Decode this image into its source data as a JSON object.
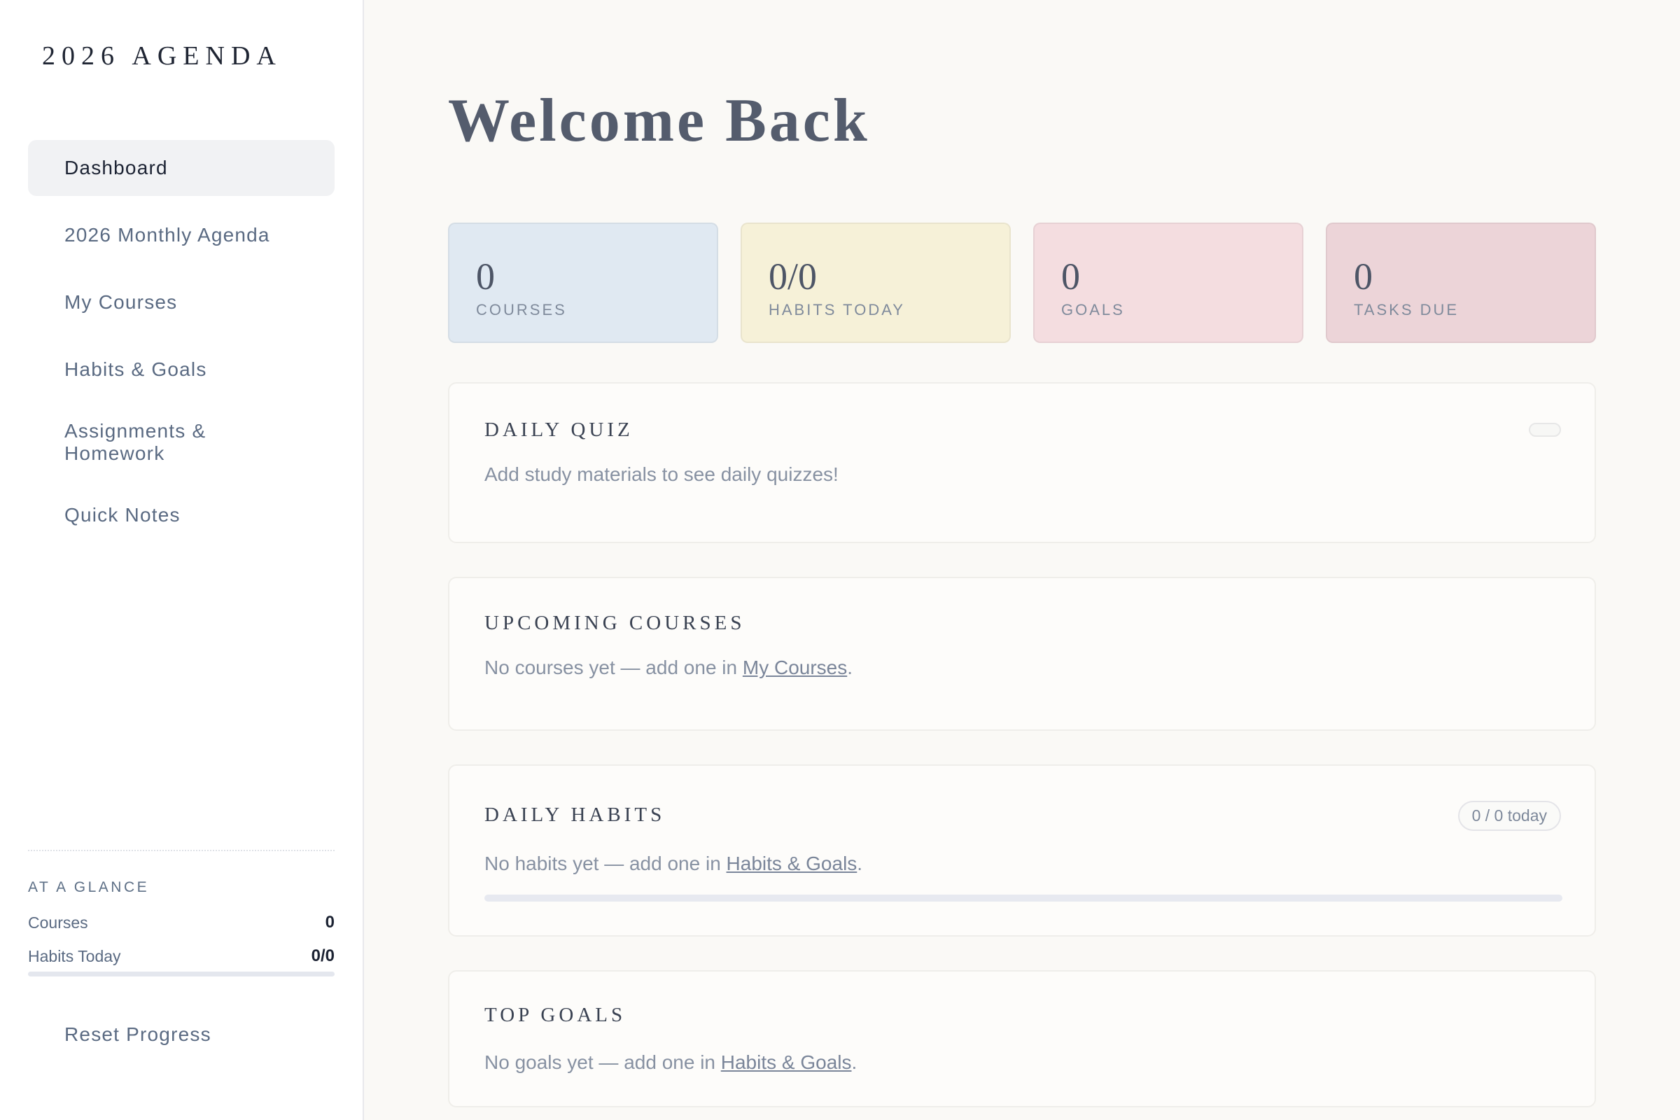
{
  "sidebar": {
    "brand": "2026 AGENDA",
    "nav": [
      {
        "label": "Dashboard",
        "active": true
      },
      {
        "label": "2026 Monthly Agenda"
      },
      {
        "label": "My Courses"
      },
      {
        "label": "Habits & Goals"
      },
      {
        "label": "Assignments & Homework"
      },
      {
        "label": "Quick Notes"
      }
    ],
    "glance": {
      "title": "AT A GLANCE",
      "courses_label": "Courses",
      "courses_value": "0",
      "habits_label": "Habits Today",
      "habits_value": "0/0",
      "habits_progress": 0
    },
    "reset_label": "Reset Progress"
  },
  "main": {
    "title": "Welcome Back",
    "stats": [
      {
        "value": "0",
        "label": "COURSES",
        "color": "#e0e9f2"
      },
      {
        "value": "0/0",
        "label": "HABITS TODAY",
        "color": "#f6f1d8"
      },
      {
        "value": "0",
        "label": "GOALS",
        "color": "#f4dde0"
      },
      {
        "value": "0",
        "label": "TASKS DUE",
        "color": "#ecd4d8"
      }
    ],
    "daily_quiz": {
      "title": "DAILY QUIZ",
      "text": "Add study materials to see daily quizzes!"
    },
    "upcoming_courses": {
      "title": "UPCOMING COURSES",
      "text_before": "No courses yet — add one in ",
      "link": "My Courses",
      "text_after": "."
    },
    "daily_habits": {
      "title": "DAILY HABITS",
      "badge": "0 / 0 today",
      "text_before": "No habits yet — add one in ",
      "link": "Habits & Goals",
      "text_after": ".",
      "progress": 0
    },
    "top_goals": {
      "title": "TOP GOALS",
      "text_before": "No goals yet — add one in ",
      "link": "Habits & Goals",
      "text_after": "."
    }
  }
}
